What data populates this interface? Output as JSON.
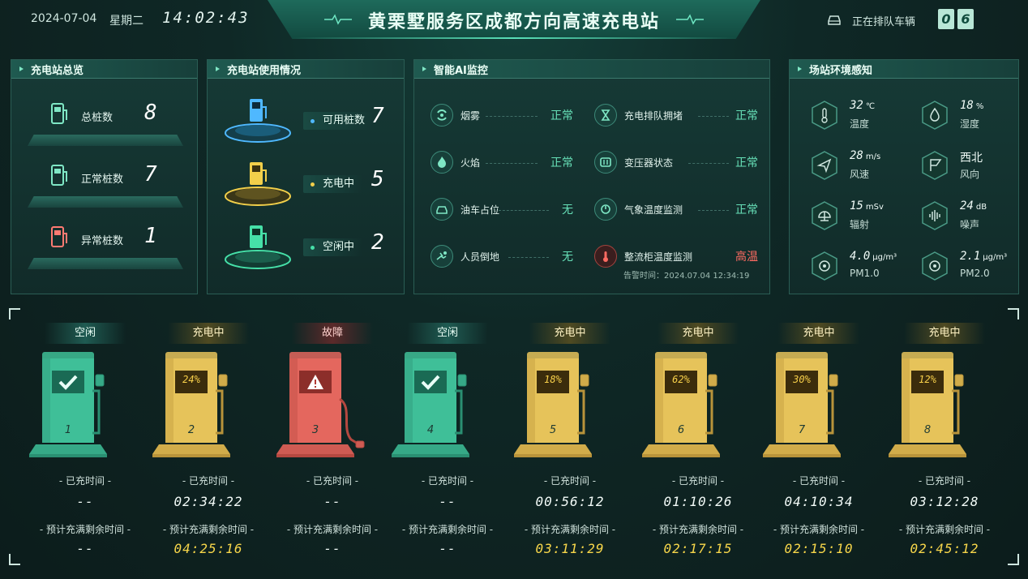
{
  "header": {
    "date": "2024-07-04",
    "weekday": "星期二",
    "time": "14:02:43",
    "title": "黄栗墅服务区成都方向高速充电站",
    "queue_label": "正在排队车辆",
    "queue_digits": [
      "0",
      "6"
    ]
  },
  "overview": {
    "title": "充电站总览",
    "rows": [
      {
        "label": "总桩数",
        "value": "8",
        "color": "#7fe7c5"
      },
      {
        "label": "正常桩数",
        "value": "7",
        "color": "#7fe7c5"
      },
      {
        "label": "异常桩数",
        "value": "1",
        "color": "#ff7a72"
      }
    ]
  },
  "usage": {
    "title": "充电站使用情况",
    "rows": [
      {
        "label": "可用桩数",
        "value": "7",
        "color": "#4fb8ff"
      },
      {
        "label": "充电中",
        "value": "5",
        "color": "#f2cf4a"
      },
      {
        "label": "空闲中",
        "value": "2",
        "color": "#46e0a8"
      }
    ]
  },
  "ai": {
    "title": "智能AI监控",
    "items": [
      {
        "label": "烟雾",
        "status": "正常",
        "icon": "smoke-icon"
      },
      {
        "label": "充电排队拥堵",
        "status": "正常",
        "icon": "hourglass-icon"
      },
      {
        "label": "火焰",
        "status": "正常",
        "icon": "flame-icon"
      },
      {
        "label": "变压器状态",
        "status": "正常",
        "icon": "transformer-icon"
      },
      {
        "label": "油车占位",
        "status": "无",
        "icon": "car-icon"
      },
      {
        "label": "气象温度监测",
        "status": "正常",
        "icon": "weather-icon"
      },
      {
        "label": "人员倒地",
        "status": "无",
        "icon": "fallen-person-icon"
      },
      {
        "label": "整流柜温度监测",
        "status": "高温",
        "icon": "thermometer-icon",
        "alarm": true
      }
    ],
    "alarm_time": "告警时间：2024.07.04 12:34:19"
  },
  "environment": {
    "title": "场站环境感知",
    "items": [
      {
        "value": "32",
        "unit": "℃",
        "name": "温度",
        "icon": "thermometer-icon"
      },
      {
        "value": "18",
        "unit": "%",
        "name": "湿度",
        "icon": "droplet-icon"
      },
      {
        "value": "28",
        "unit": "m/s",
        "name": "风速",
        "icon": "wind-speed-icon"
      },
      {
        "value": "西北",
        "unit": "",
        "name": "风向",
        "icon": "wind-direction-icon"
      },
      {
        "value": "15",
        "unit": "mSv",
        "name": "辐射",
        "icon": "radiation-icon"
      },
      {
        "value": "24",
        "unit": "dB",
        "name": "噪声",
        "icon": "noise-icon"
      },
      {
        "value": "4.0",
        "unit": "μg/m³",
        "name": "PM1.0",
        "icon": "pm-icon"
      },
      {
        "value": "2.1",
        "unit": "μg/m³",
        "name": "PM2.0",
        "icon": "pm-icon"
      }
    ]
  },
  "piles_labels": {
    "charged": "- 已充时间 -",
    "remaining": "- 预计充满剩余时间 -"
  },
  "piles": [
    {
      "number": "1",
      "status": "空闲",
      "state": "idle",
      "charged": "--",
      "remaining": "--"
    },
    {
      "number": "2",
      "status": "充电中",
      "state": "charging",
      "percent": "24%",
      "charged": "02:34:22",
      "remaining": "04:25:16"
    },
    {
      "number": "3",
      "status": "故障",
      "state": "fault",
      "charged": "--",
      "remaining": "--"
    },
    {
      "number": "4",
      "status": "空闲",
      "state": "idle",
      "charged": "--",
      "remaining": "--"
    },
    {
      "number": "5",
      "status": "充电中",
      "state": "charging",
      "percent": "18%",
      "charged": "00:56:12",
      "remaining": "03:11:29"
    },
    {
      "number": "6",
      "status": "充电中",
      "state": "charging",
      "percent": "62%",
      "charged": "01:10:26",
      "remaining": "02:17:15"
    },
    {
      "number": "7",
      "status": "充电中",
      "state": "charging",
      "percent": "30%",
      "charged": "04:10:34",
      "remaining": "02:15:10"
    },
    {
      "number": "8",
      "status": "充电中",
      "state": "charging",
      "percent": "12%",
      "charged": "03:12:28",
      "remaining": "02:45:12"
    }
  ],
  "colors": {
    "idle": "#3fbf98",
    "charging": "#e6c35a",
    "fault": "#e4675e",
    "ok_text": "#67e0b8",
    "alarm_text": "#ff6b62"
  }
}
